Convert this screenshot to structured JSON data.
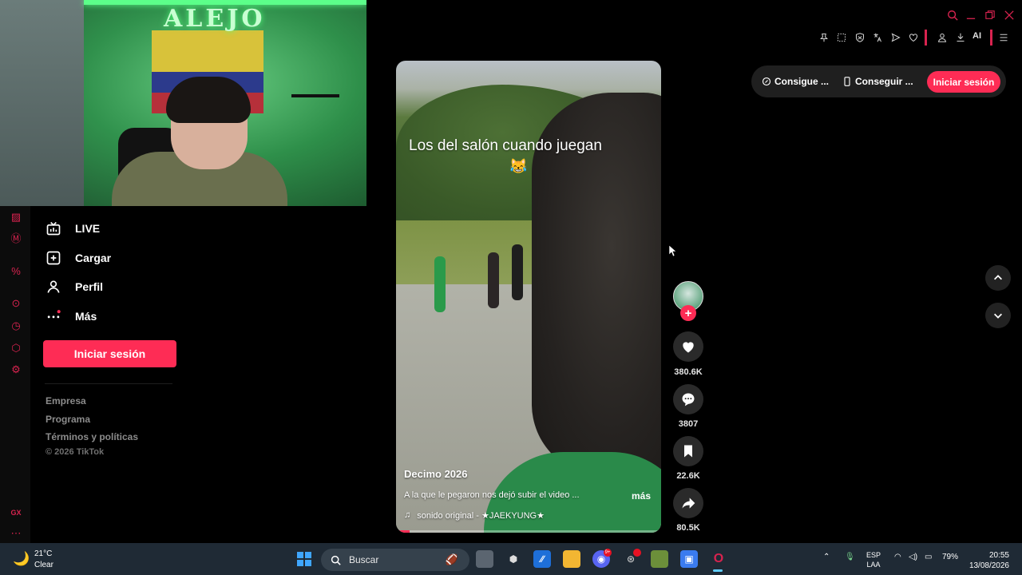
{
  "webcam": {
    "sign_text": "ALEJO"
  },
  "sidebar": {
    "items": [
      {
        "label": "LIVE",
        "icon": "live-icon"
      },
      {
        "label": "Cargar",
        "icon": "upload-icon"
      },
      {
        "label": "Perfil",
        "icon": "profile-icon"
      },
      {
        "label": "Más",
        "icon": "more-icon"
      }
    ],
    "login_label": "Iniciar sesión",
    "footer_links": [
      "Empresa",
      "Programa",
      "Términos y políticas"
    ],
    "copyright": "© 2026 TikTok"
  },
  "header": {
    "get_coins_label": "Consigue ...",
    "get_app_label": "Conseguir ...",
    "login_label": "Iniciar sesión",
    "ai_label": "AI"
  },
  "video": {
    "caption": "Los del salón cuando juegan",
    "caption_emoji": "😹",
    "author": "Decimo 2026",
    "description": "A la que le pegaron nos dejó subir el video ...",
    "more_label": "más",
    "sound": "sonido original - ★JAEKYUNG★",
    "progress": 0.05
  },
  "actions": {
    "likes": "380.6K",
    "comments": "3807",
    "saves": "22.6K",
    "shares": "80.5K"
  },
  "taskbar": {
    "temperature": "21°C",
    "condition": "Clear",
    "search_placeholder": "Buscar",
    "discord_badge": "9+",
    "battery": "79%",
    "language_top": "ESP",
    "language_bottom": "LAA",
    "time": "20:55",
    "date": "13/08/2026"
  },
  "colors": {
    "accent": "#fe2c55",
    "gx_red": "#d8234f",
    "taskbar": "#1f2a35"
  }
}
